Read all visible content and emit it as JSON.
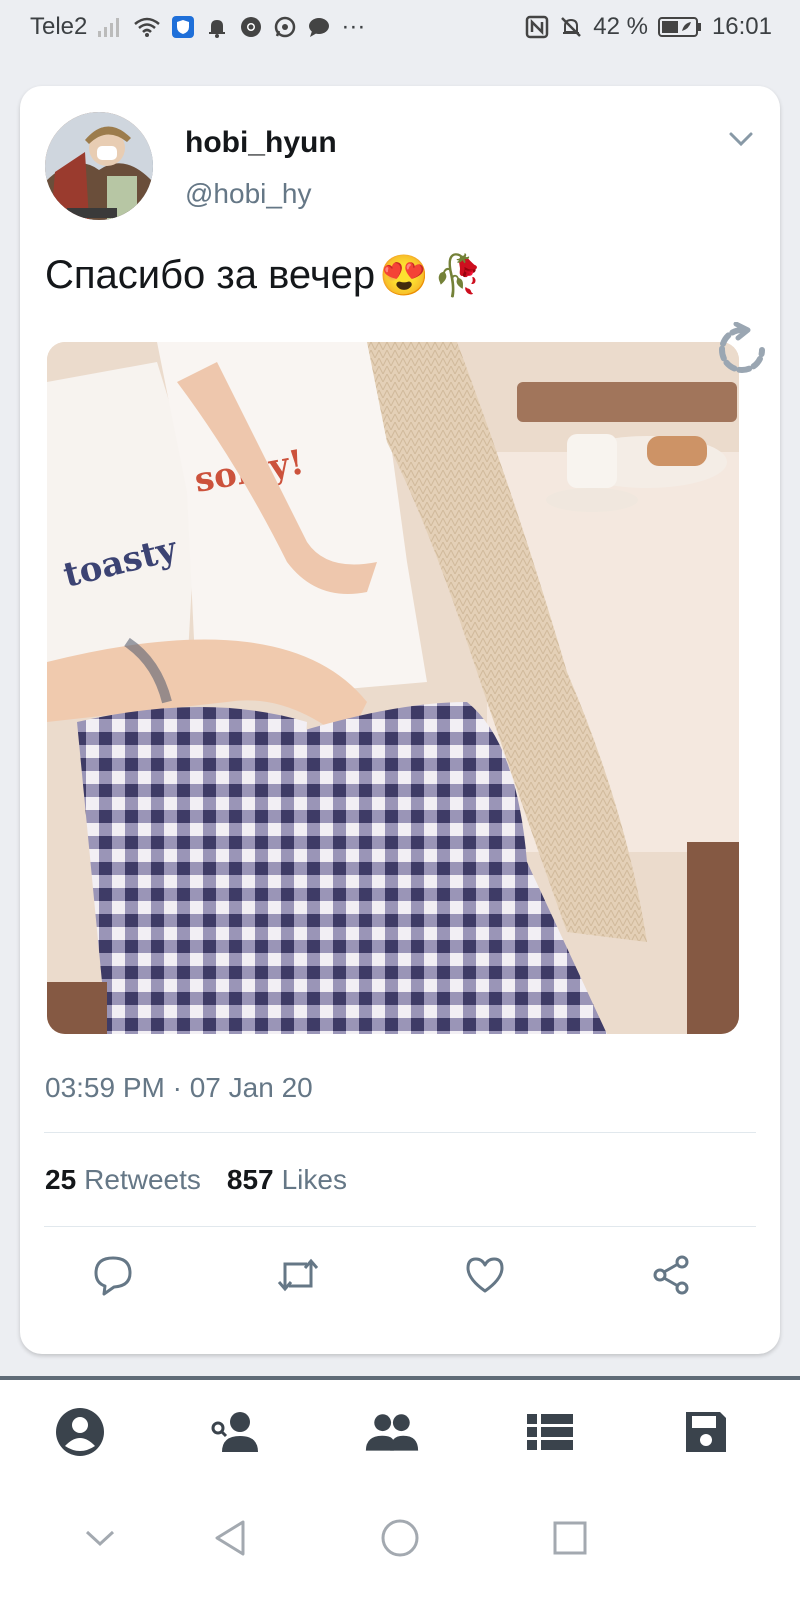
{
  "status_bar": {
    "carrier": "Tele2",
    "more": "···",
    "battery_percent": "42 %",
    "time": "16:01",
    "left_icons": [
      "signal-icon",
      "wifi-icon",
      "shield-icon",
      "alarm-icon",
      "chrome-icon",
      "whatsapp-icon",
      "message-icon"
    ],
    "right_icons": [
      "nfc-icon",
      "mute-icon",
      "battery-icon"
    ]
  },
  "tweet": {
    "display_name": "hobi_hyun",
    "handle": "@hobi_hy",
    "text": "Спасибо за вечер",
    "emojis": [
      "😍",
      "🥀"
    ],
    "timestamp": "03:59 PM · 07 Jan 20",
    "retweets_count": "25",
    "retweets_label": "Retweets",
    "likes_count": "857",
    "likes_label": "Likes"
  },
  "colors": {
    "accent": "#657786",
    "text": "#14171a",
    "background": "#eceef2",
    "nav_icon": "#3a434c"
  },
  "actions": [
    "reply-icon",
    "retweet-icon",
    "like-icon",
    "share-icon"
  ],
  "bottom_nav": [
    "profile-icon",
    "follow-user-icon",
    "group-icon",
    "list-icon",
    "save-icon"
  ],
  "system_nav": [
    "collapse-icon",
    "back-icon",
    "home-icon",
    "recents-icon"
  ]
}
